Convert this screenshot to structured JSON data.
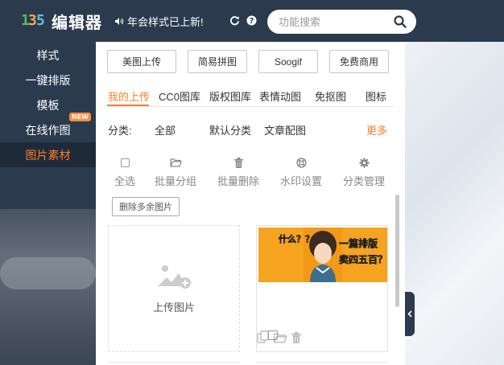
{
  "header": {
    "logo_text": "编辑器",
    "notice": "年会样式已上新!",
    "search_placeholder": "功能搜索"
  },
  "leftnav": {
    "items": [
      {
        "label": "样式",
        "active": false
      },
      {
        "label": "一键排版",
        "active": false
      },
      {
        "label": "模板",
        "active": false
      },
      {
        "label": "在线作图",
        "active": false,
        "badge": "NEW"
      },
      {
        "label": "图片素材",
        "active": true
      }
    ]
  },
  "panel": {
    "sources": [
      "美图上传",
      "简易拼图",
      "Soogif",
      "免费商用"
    ],
    "tabs": [
      "我的上传",
      "CC0图库",
      "版权图库",
      "表情动图",
      "免抠图",
      "图标"
    ],
    "active_tab": "我的上传",
    "category_label": "分类:",
    "categories": [
      "全部",
      "默认分类",
      "文章配图"
    ],
    "more": "更多",
    "actions": [
      {
        "label": "全选",
        "icon": "checkbox-icon"
      },
      {
        "label": "批量分组",
        "icon": "folder-open-icon"
      },
      {
        "label": "批量删除",
        "icon": "trash-icon"
      },
      {
        "label": "水印设置",
        "icon": "lifebuoy-icon"
      },
      {
        "label": "分类管理",
        "icon": "gear-icon"
      }
    ],
    "delete_extra": "删除多余图片",
    "upload_label": "上传图片",
    "thumb_text": {
      "left": "什么？？",
      "right_line1": "一篇排版",
      "right_line2": "卖四五百？"
    }
  },
  "colors": {
    "nav_bg": "#2b3a4d",
    "accent": "#ff7d2a",
    "badge": "#ff8c37"
  }
}
